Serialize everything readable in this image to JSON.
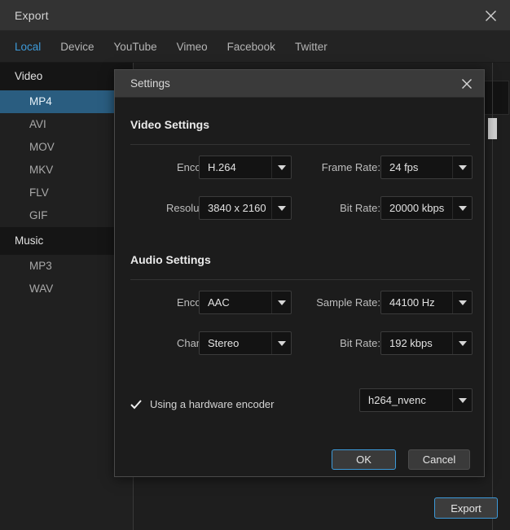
{
  "window": {
    "title": "Export",
    "close_icon": "close-icon"
  },
  "tabs": [
    {
      "label": "Local",
      "active": true
    },
    {
      "label": "Device",
      "active": false
    },
    {
      "label": "YouTube",
      "active": false
    },
    {
      "label": "Vimeo",
      "active": false
    },
    {
      "label": "Facebook",
      "active": false
    },
    {
      "label": "Twitter",
      "active": false
    }
  ],
  "sidebar": {
    "groups": [
      {
        "label": "Video",
        "items": [
          {
            "label": "MP4",
            "selected": true
          },
          {
            "label": "AVI",
            "selected": false
          },
          {
            "label": "MOV",
            "selected": false
          },
          {
            "label": "MKV",
            "selected": false
          },
          {
            "label": "FLV",
            "selected": false
          },
          {
            "label": "GIF",
            "selected": false
          }
        ]
      },
      {
        "label": "Music",
        "items": [
          {
            "label": "MP3",
            "selected": false
          },
          {
            "label": "WAV",
            "selected": false
          }
        ]
      }
    ]
  },
  "footer": {
    "export_label": "Export"
  },
  "dialog": {
    "title": "Settings",
    "close_icon": "close-icon",
    "video_section": {
      "title": "Video Settings",
      "fields": [
        {
          "label": "Encoder:",
          "value": "H.264"
        },
        {
          "label": "Frame Rate:",
          "value": "24 fps"
        },
        {
          "label": "Resolution:",
          "value": "3840 x 2160"
        },
        {
          "label": "Bit Rate:",
          "value": "20000 kbps"
        }
      ]
    },
    "audio_section": {
      "title": "Audio Settings",
      "fields": [
        {
          "label": "Encoder:",
          "value": "AAC"
        },
        {
          "label": "Sample Rate:",
          "value": "44100 Hz"
        },
        {
          "label": "Channel:",
          "value": "Stereo"
        },
        {
          "label": "Bit Rate:",
          "value": "192 kbps"
        }
      ]
    },
    "hardware_encoder": {
      "label": "Using a hardware encoder",
      "checked": true,
      "value": "h264_nvenc"
    },
    "buttons": {
      "ok": "OK",
      "cancel": "Cancel"
    }
  },
  "colors": {
    "accent": "#3d9ad9",
    "selection": "#2a5d80",
    "window_bg": "#1e1e1e",
    "dialog_bg": "#1c1c1c",
    "titlebar_bg": "#333333"
  }
}
